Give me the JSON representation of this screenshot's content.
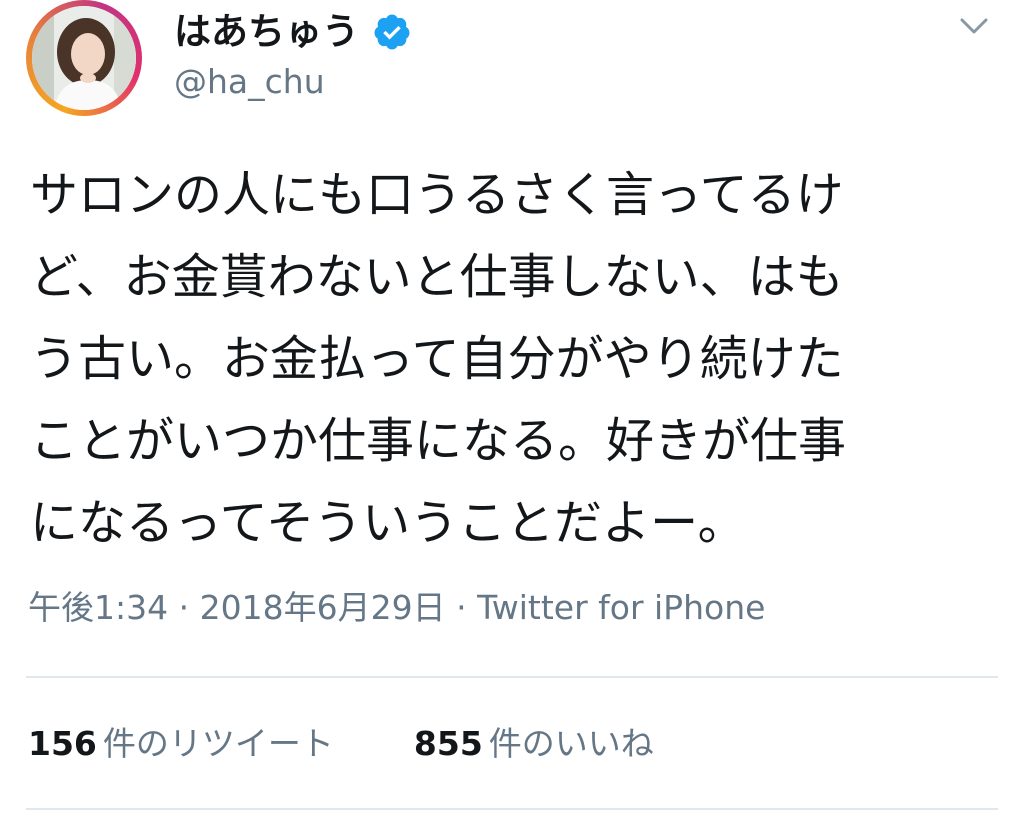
{
  "user": {
    "display_name": "はあちゅう",
    "handle": "@ha_chu"
  },
  "tweet": {
    "lines": [
      "サロンの人にも口うるさく言ってるけ",
      "ど、お金貰わないと仕事しない、はも",
      "う古い。お金払って自分がやり続けた",
      "ことがいつか仕事になる。好きが仕事",
      "になるってそういうことだよー。"
    ]
  },
  "meta": {
    "time": "午後1:34",
    "date": "2018年6月29日",
    "source": "Twitter for iPhone",
    "separator": " · "
  },
  "stats": {
    "retweets": "156",
    "retweets_label": "件のリツイート",
    "likes": "855",
    "likes_label": "件のいいね"
  },
  "icons": {
    "verified": "verified-badge-icon",
    "menu": "chevron-down-icon"
  },
  "colors": {
    "verified": "#1da1f2",
    "secondary_text": "#657786",
    "primary_text": "#14171a",
    "divider": "#e1e8ed"
  }
}
